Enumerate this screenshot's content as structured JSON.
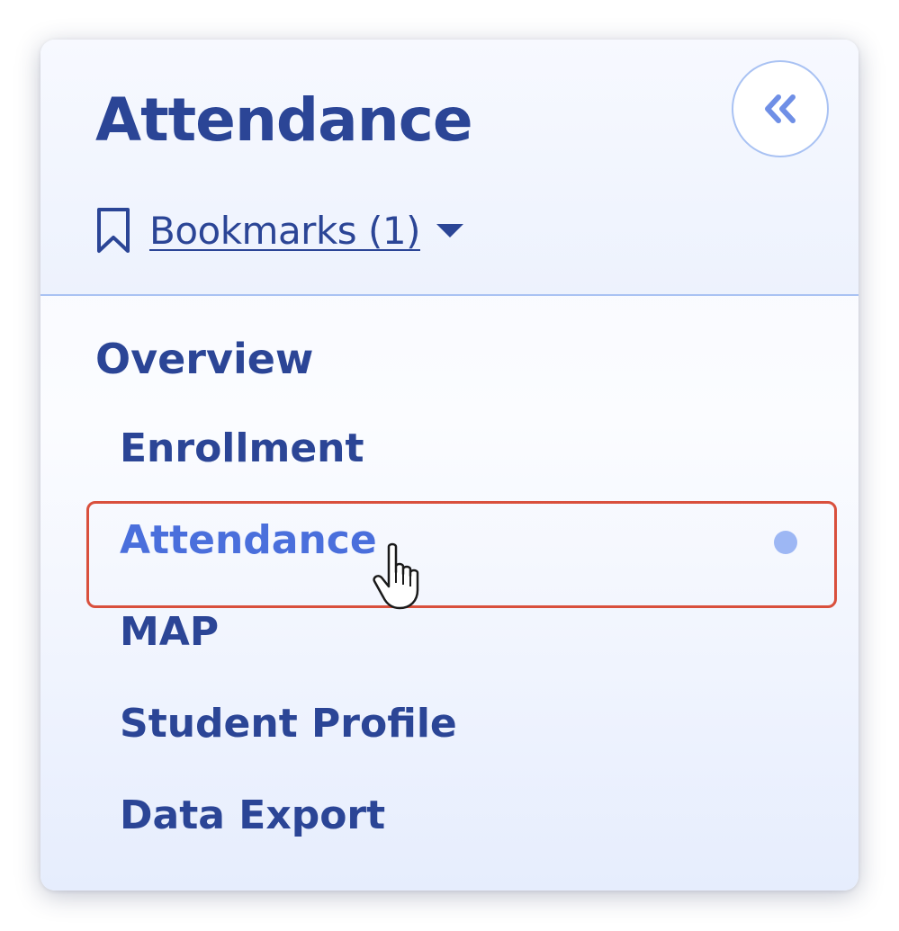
{
  "header": {
    "title": "Attendance",
    "collapse_icon": "double-chevron-left-icon",
    "bookmarks_label": "Bookmarks (1)",
    "bookmark_icon": "bookmark-icon",
    "caret_icon": "caret-down-icon"
  },
  "nav": {
    "section_heading": "Overview",
    "items": [
      {
        "label": "Enrollment",
        "active": false
      },
      {
        "label": "Attendance",
        "active": true
      },
      {
        "label": "MAP",
        "active": false
      },
      {
        "label": "Student Profile",
        "active": false
      },
      {
        "label": "Data Export",
        "active": false
      }
    ]
  },
  "colors": {
    "primary_text": "#2b4596",
    "active_text": "#4a6fdc",
    "active_dot": "#9db7f4",
    "highlight_border": "#d9503d",
    "divider": "#a9c2f3"
  }
}
